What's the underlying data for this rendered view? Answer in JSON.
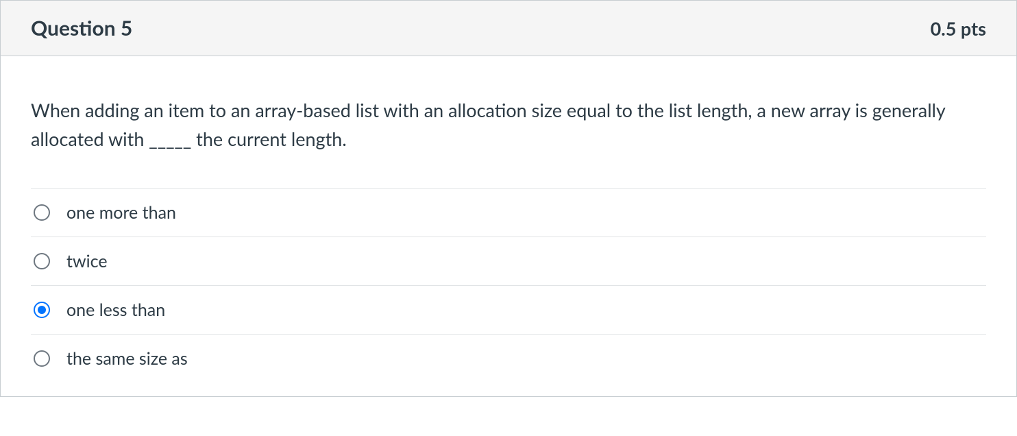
{
  "header": {
    "title": "Question 5",
    "points": "0.5 pts"
  },
  "question": {
    "text": "When adding an item to an array-based list with an allocation size equal to the list length, a new array is generally allocated with _____ the current length."
  },
  "answers": [
    {
      "label": "one more than",
      "selected": false
    },
    {
      "label": "twice",
      "selected": false
    },
    {
      "label": "one less than",
      "selected": true
    },
    {
      "label": "the same size as",
      "selected": false
    }
  ]
}
